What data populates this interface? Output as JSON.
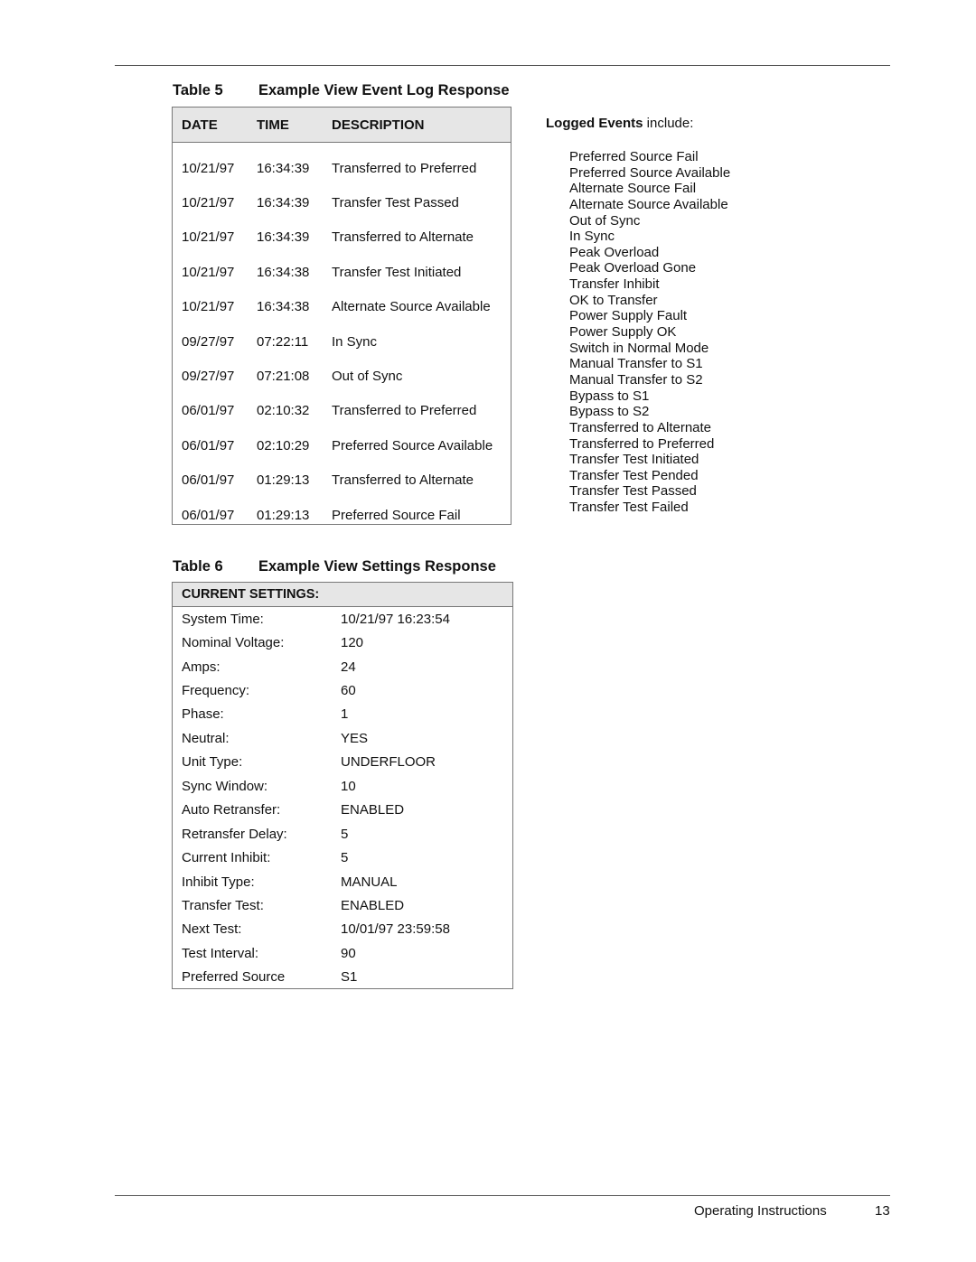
{
  "table5": {
    "label": "Table 5",
    "title": "Example View Event Log Response",
    "headers": [
      "DATE",
      "TIME",
      "DESCRIPTION"
    ],
    "rows": [
      {
        "date": "10/21/97",
        "time": "16:34:39",
        "description": "Transferred to Preferred"
      },
      {
        "date": "10/21/97",
        "time": "16:34:39",
        "description": "Transfer Test Passed"
      },
      {
        "date": "10/21/97",
        "time": "16:34:39",
        "description": "Transferred to Alternate"
      },
      {
        "date": "10/21/97",
        "time": "16:34:38",
        "description": "Transfer Test Initiated"
      },
      {
        "date": "10/21/97",
        "time": "16:34:38",
        "description": "Alternate Source Available"
      },
      {
        "date": "09/27/97",
        "time": "07:22:11",
        "description": "In Sync"
      },
      {
        "date": "09/27/97",
        "time": "07:21:08",
        "description": "Out of Sync"
      },
      {
        "date": "06/01/97",
        "time": "02:10:32",
        "description": "Transferred to Preferred"
      },
      {
        "date": "06/01/97",
        "time": "02:10:29",
        "description": "Preferred Source Available"
      },
      {
        "date": "06/01/97",
        "time": "01:29:13",
        "description": "Transferred to Alternate"
      },
      {
        "date": "06/01/97",
        "time": "01:29:13",
        "description": "Preferred Source Fail"
      }
    ]
  },
  "logged_events": {
    "intro_bold": "Logged Events",
    "intro_rest": " include:",
    "items": [
      "Preferred Source Fail",
      "Preferred Source Available",
      "Alternate Source Fail",
      "Alternate Source Available",
      "Out of Sync",
      "In Sync",
      "Peak Overload",
      "Peak Overload Gone",
      "Transfer Inhibit",
      "OK to Transfer",
      "Power Supply Fault",
      "Power Supply OK",
      "Switch in Normal Mode",
      "Manual Transfer to S1",
      "Manual Transfer to S2",
      "Bypass to S1",
      "Bypass to S2",
      "Transferred to Alternate",
      "Transferred to Preferred",
      "Transfer Test Initiated",
      "Transfer Test Pended",
      "Transfer Test Passed",
      "Transfer Test Failed"
    ]
  },
  "table6": {
    "label": "Table 6",
    "title": "Example View Settings Response",
    "header": "CURRENT SETTINGS:",
    "rows": [
      {
        "key": "System Time:",
        "value": "10/21/97 16:23:54"
      },
      {
        "key": "Nominal Voltage:",
        "value": "120"
      },
      {
        "key": "Amps:",
        "value": "24"
      },
      {
        "key": "Frequency:",
        "value": "60"
      },
      {
        "key": "Phase:",
        "value": "1"
      },
      {
        "key": "Neutral:",
        "value": "YES"
      },
      {
        "key": "Unit Type:",
        "value": "UNDERFLOOR"
      },
      {
        "key": "Sync Window:",
        "value": "10"
      },
      {
        "key": "Auto Retransfer:",
        "value": "ENABLED"
      },
      {
        "key": "Retransfer Delay:",
        "value": "5"
      },
      {
        "key": "Current Inhibit:",
        "value": "5"
      },
      {
        "key": "Inhibit Type:",
        "value": "MANUAL"
      },
      {
        "key": "Transfer Test:",
        "value": "ENABLED"
      },
      {
        "key": "Next Test:",
        "value": "10/01/97 23:59:58"
      },
      {
        "key": "Test Interval:",
        "value": "90"
      },
      {
        "key": "Preferred Source",
        "value": "S1"
      }
    ]
  },
  "footer": {
    "section": "Operating Instructions",
    "page": "13"
  }
}
